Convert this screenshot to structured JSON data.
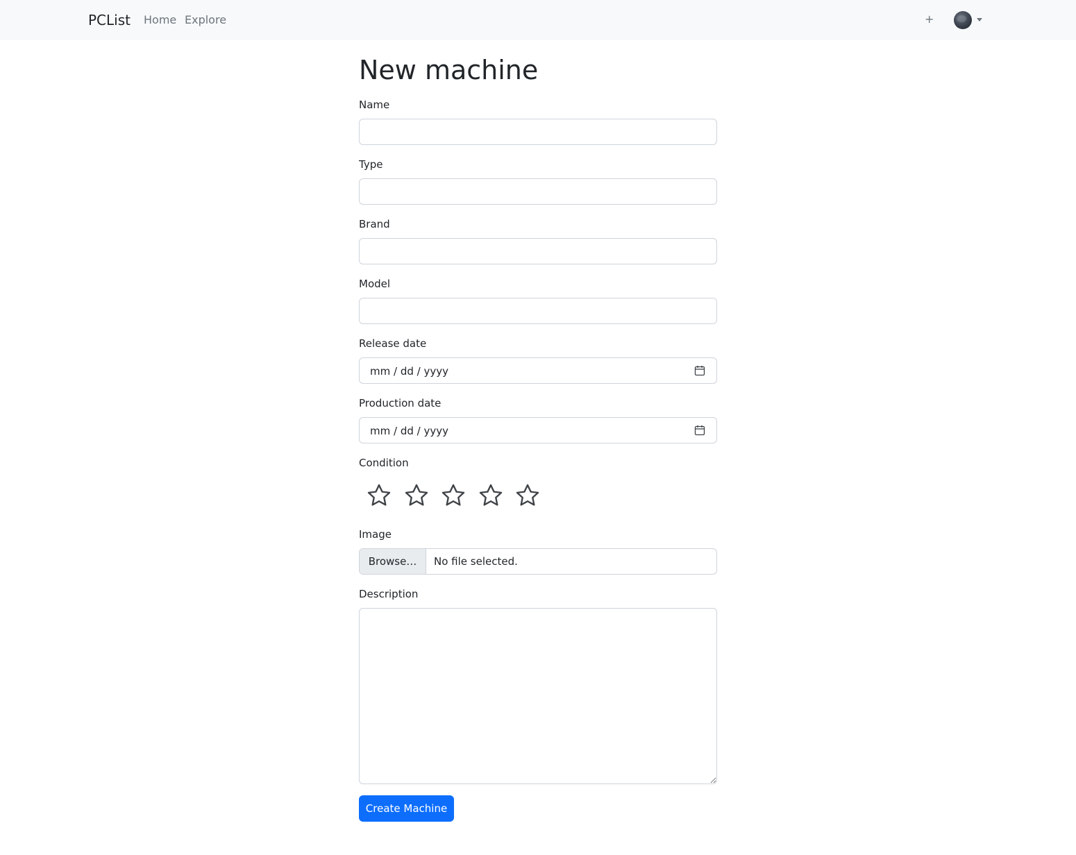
{
  "navbar": {
    "brand": "PCList",
    "links": [
      "Home",
      "Explore"
    ],
    "add_label": "+"
  },
  "page": {
    "title": "New machine"
  },
  "form": {
    "name_label": "Name",
    "name_value": "",
    "type_label": "Type",
    "type_value": "",
    "brand_label": "Brand",
    "brand_value": "",
    "model_label": "Model",
    "model_value": "",
    "release_date_label": "Release date",
    "release_date_placeholder": "mm / dd / yyyy",
    "production_date_label": "Production date",
    "production_date_placeholder": "mm / dd / yyyy",
    "condition_label": "Condition",
    "condition_rating": 0,
    "condition_max": 5,
    "image_label": "Image",
    "image_button": "Browse…",
    "image_status": "No file selected.",
    "description_label": "Description",
    "description_value": "",
    "submit_label": "Create Machine"
  },
  "colors": {
    "primary": "#0d6efd",
    "navbar_bg": "#f8f9fa",
    "muted_text": "#6c757d",
    "star_outline": "#3f4347"
  },
  "icons": {
    "calendar": "calendar-icon",
    "star": "star-outline-icon",
    "avatar_caret": "caret-down-icon"
  }
}
